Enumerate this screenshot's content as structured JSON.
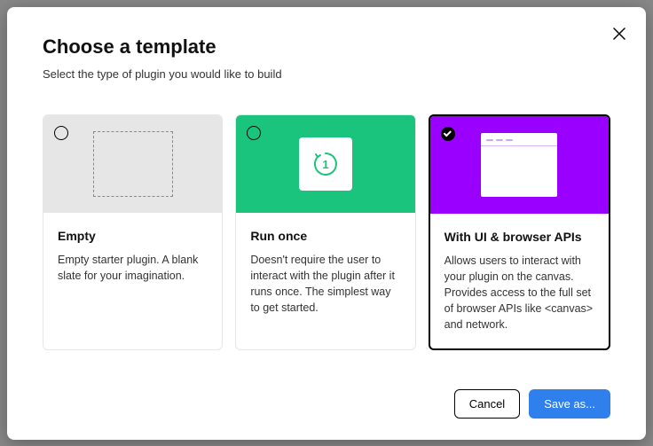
{
  "modal": {
    "title": "Choose a template",
    "subtitle": "Select the type of plugin you would like to build"
  },
  "templates": [
    {
      "id": "empty",
      "title": "Empty",
      "description": "Empty starter plugin. A blank slate for your imagination.",
      "selected": false
    },
    {
      "id": "run-once",
      "title": "Run once",
      "description": "Doesn't require the user to interact with the plugin after it runs once. The simplest way to get started.",
      "selected": false
    },
    {
      "id": "ui-browser",
      "title": "With UI & browser APIs",
      "description": "Allows users to interact with your plugin on the canvas. Provides access to the full set of browser APIs like <canvas> and network.",
      "selected": true
    }
  ],
  "footer": {
    "cancel": "Cancel",
    "save": "Save as..."
  }
}
